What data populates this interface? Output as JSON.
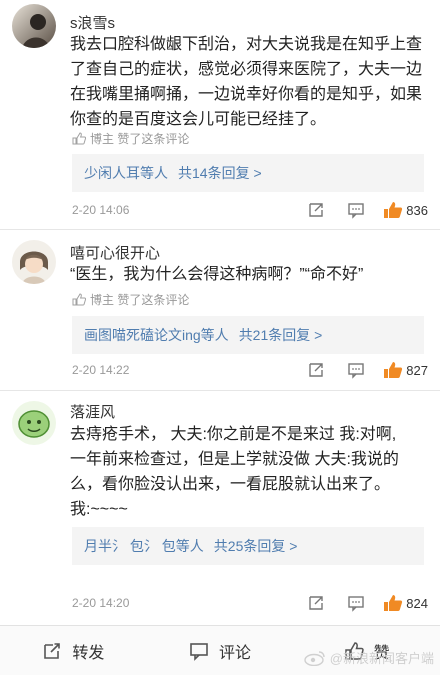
{
  "comments": [
    {
      "username": "s浪雪s",
      "lines": [
        "我去口腔科做龈下刮治，对大夫说我是在知乎上查",
        "了查自己的症状，感觉必须得来医院了，大夫一边",
        "在我嘴里捅啊捅，一边说幸好你看的是知乎，如果",
        "你查的是百度这会儿可能已经挂了。"
      ],
      "liked_by": "博主 赞了这条评论",
      "replies_users": "少闲人耳等人",
      "replies_count": "共14条回复 >",
      "time": "2-20 14:06",
      "likes": "836"
    },
    {
      "username": "嘻可心很开心",
      "lines": [
        "“医生，我为什么会得这种病啊？”“命不好”"
      ],
      "liked_by": "博主 赞了这条评论",
      "replies_users": "画图喵死磕论文ing等人",
      "replies_count": "共21条回复 >",
      "time": "2-20 14:22",
      "likes": "827"
    },
    {
      "username": "落涯风",
      "lines": [
        "去痔疮手术，  大夫:你之前是不是来过 我:对啊,",
        "一年前来检查过，但是上学就没做 大夫:我说的",
        "么，看你脸没认出来，一看屁股就认出来了。",
        "我:~~~~"
      ],
      "replies_users": "月半氵 包氵 包等人",
      "replies_count": "共25条回复 >",
      "time": "2-20 14:20",
      "likes": "824"
    }
  ],
  "bottom_bar": {
    "repost": "转发",
    "comment": "评论",
    "like": "赞"
  },
  "watermark": "@新浪新闻客户端",
  "colors": {
    "link": "#507daf",
    "like_orange": "#f08a24",
    "muted": "#999999"
  }
}
